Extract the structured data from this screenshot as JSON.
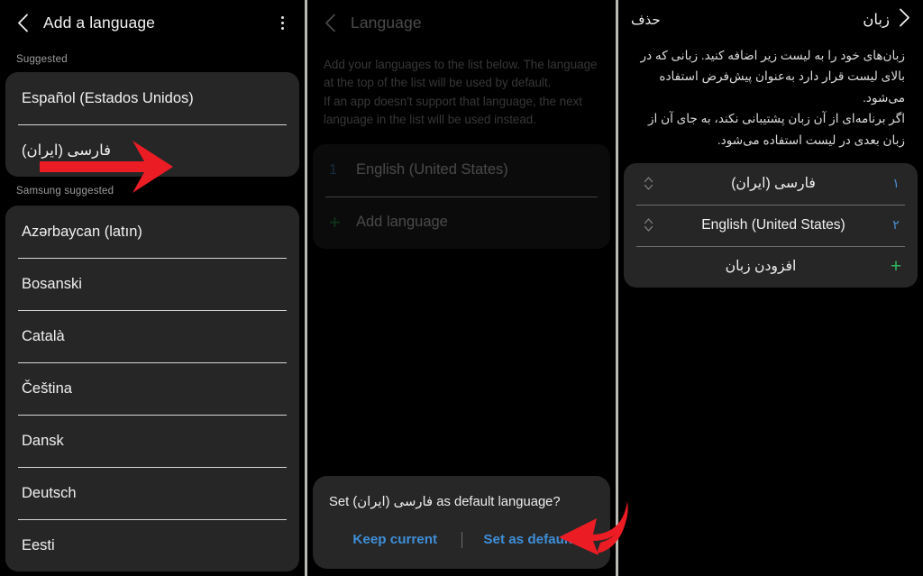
{
  "left_panel": {
    "header": {
      "title": "Add a language",
      "back_icon": "chevron-left-icon",
      "overflow_icon": "more-vertical-icon"
    },
    "sections": [
      {
        "label": "Suggested",
        "items": [
          {
            "name": "Español (Estados Unidos)",
            "rtl": false
          },
          {
            "name": "فارسی (ایران)",
            "rtl": true
          }
        ]
      },
      {
        "label": "Samsung suggested",
        "items": [
          {
            "name": "Azərbaycan (latın)",
            "rtl": false
          },
          {
            "name": "Bosanski",
            "rtl": false
          },
          {
            "name": "Català",
            "rtl": false
          },
          {
            "name": "Čeština",
            "rtl": false
          },
          {
            "name": "Dansk",
            "rtl": false
          },
          {
            "name": "Deutsch",
            "rtl": false
          },
          {
            "name": "Eesti",
            "rtl": false
          }
        ]
      }
    ]
  },
  "middle_panel": {
    "header": {
      "title": "Language",
      "back_icon": "chevron-left-icon"
    },
    "description": [
      "Add your languages to the list below. The language at the top of the list will be used by default.",
      "If an app doesn't support that language, the next language in the list will be used instead."
    ],
    "language_rows": [
      {
        "index": "1",
        "name": "English (United States)"
      }
    ],
    "add_language_label": "Add language",
    "add_icon": "plus-icon",
    "dialog": {
      "message": "Set فارسی (ایران) as default language?",
      "keep_button": "Keep current",
      "default_button": "Set as default",
      "accent": "#3f8ed8"
    }
  },
  "right_panel": {
    "header": {
      "title": "زبان",
      "action": "حذف",
      "back_icon": "chevron-right-icon"
    },
    "description": [
      "زبان‌های خود را به لیست زیر اضافه کنید. زبانی که در بالای لیست قرار دارد به‌عنوان پیش‌فرض استفاده می‌شود.",
      "اگر برنامه‌ای از آن زبان پشتیبانی نکند، به جای آن از زبان بعدی در لیست استفاده می‌شود."
    ],
    "language_rows": [
      {
        "index": "۱",
        "name": "فارسی (ایران)",
        "handle_icon": "reorder-handle-icon"
      },
      {
        "index": "۲",
        "name": "English (United States)",
        "handle_icon": "reorder-handle-icon"
      }
    ],
    "add_language_label": "افزودن زبان",
    "add_icon": "plus-icon"
  },
  "annotations": {
    "arrow_color": "#ec1c24",
    "straight_arrow": "points-right-to-farsi-row",
    "curved_arrow": "points-left-to-set-as-default"
  }
}
